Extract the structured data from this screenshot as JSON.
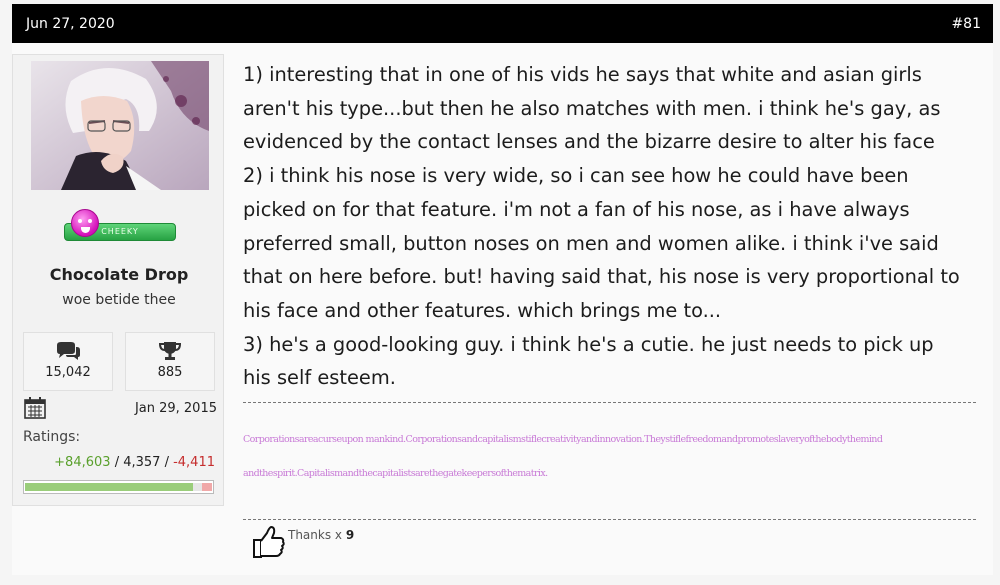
{
  "post": {
    "date": "Jun 27, 2020",
    "number": "#81"
  },
  "user": {
    "name": "Chocolate Drop",
    "title": "woe betide thee",
    "badge": "CHEEKY",
    "messages": "15,042",
    "trophies": "885",
    "joined": "Jan 29, 2015",
    "ratings_label": "Ratings:",
    "ratings_pos": "+84,603",
    "ratings_neu": "4,357",
    "ratings_neg": "-4,411",
    "rating_bar": {
      "positive": 0.9,
      "neutral": 0.05,
      "negative": 0.05
    }
  },
  "message": {
    "lines": [
      "1) interesting that in one of his vids he says that white and asian girls",
      "aren't his type...but then he also matches with men. i think he's gay, as",
      "evidenced by the contact lenses and the bizarre desire to alter his face",
      "2) i think his nose is very wide, so i can see how he could have been",
      "picked on for that feature. i'm not a fan of his nose, as i have always",
      "preferred small, button noses on men and women alike. i think i've said",
      "that on here before. but! having said that, his nose is very proportional to",
      "his face and other features. which brings me to...",
      "3) he's a good-looking guy. i think he's a cutie. he just needs to pick up",
      "his self esteem."
    ]
  },
  "signature": {
    "line1": "Corporationsareacurseupon mankind.Corporationsandcapitalismstiflecreativityandinnovation.Theystiflefreedomandpromoteslaveryofthebodythemind",
    "line2": "andthespirit.Capitalismandthecapitalistsarethegatekeepersofthematrix."
  },
  "thanks": {
    "label": "Thanks x",
    "count": "9"
  },
  "icons": [
    "comments-icon",
    "trophy-icon",
    "calendar-icon",
    "thumbs-up-icon"
  ]
}
